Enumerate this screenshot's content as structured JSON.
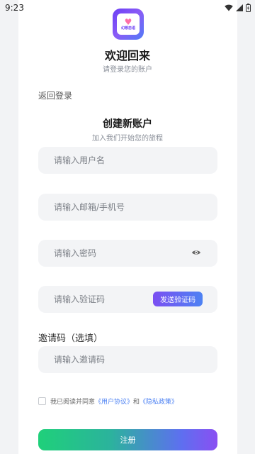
{
  "status_bar": {
    "time": "9:23"
  },
  "brand": {
    "logo_text": "幻想恋语"
  },
  "header": {
    "title": "欢迎回来",
    "subtitle": "请登录您的账户"
  },
  "nav": {
    "back_label": "返回登录"
  },
  "register": {
    "title": "创建新账户",
    "subtitle": "加入我们开始您的旅程",
    "username_placeholder": "请输入用户名",
    "email_placeholder": "请输入邮箱/手机号",
    "password_placeholder": "请输入密码",
    "code_placeholder": "请输入验证码",
    "send_code_label": "发送验证码",
    "invite_label": "邀请码（选填）",
    "invite_placeholder": "请输入邀请码",
    "agree_prefix": "我已阅读并同意",
    "user_agreement": "《用户协议》",
    "and": "和",
    "privacy_policy": "《隐私政策》",
    "submit_label": "注册"
  },
  "colors": {
    "accent_purple": "#7b4ff2",
    "accent_blue": "#4d82f3",
    "accent_green": "#1fd07a",
    "field_bg": "#f3f4f6"
  }
}
